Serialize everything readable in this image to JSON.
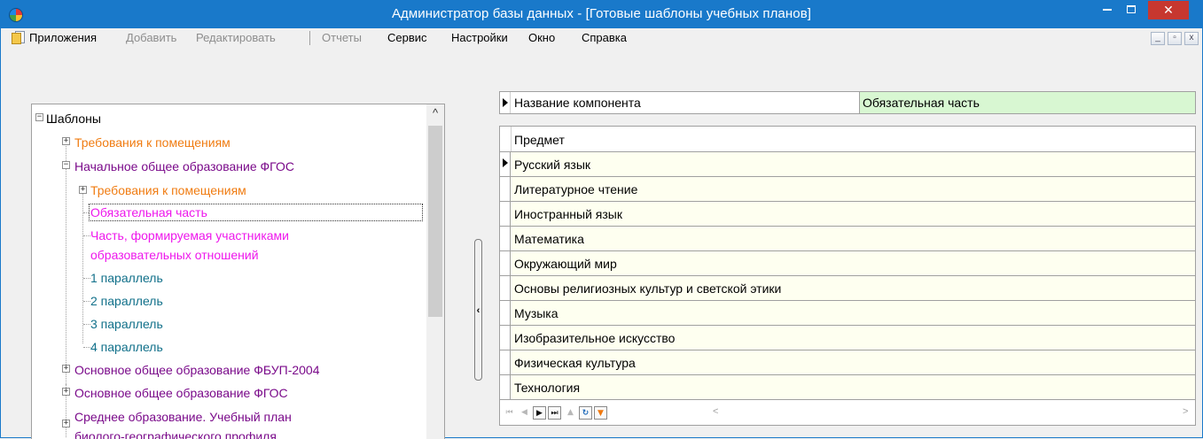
{
  "window": {
    "title": "Администратор базы данных - [Готовые шаблоны учебных планов]",
    "accent_color": "#1979ca",
    "close_color": "#c7372f",
    "min_glyph": "",
    "max_glyph": "",
    "close_glyph": "✕"
  },
  "menu": {
    "items": [
      {
        "label": "Приложения",
        "enabled": true
      },
      {
        "label": "Добавить",
        "enabled": false
      },
      {
        "label": "Редактировать",
        "enabled": false
      },
      {
        "label": "Отчеты",
        "enabled": false
      },
      {
        "label": "Сервис",
        "enabled": true
      },
      {
        "label": "Настройки",
        "enabled": true
      },
      {
        "label": "Окно",
        "enabled": true
      },
      {
        "label": "Справка",
        "enabled": true
      }
    ],
    "mdi_buttons": [
      "_",
      "▫",
      "x"
    ]
  },
  "tree": {
    "root": "Шаблоны",
    "nodes": [
      {
        "label": "Требования к помещениям",
        "color": "#f07c12"
      },
      {
        "label": "Начальное общее образование ФГОС",
        "color": "#7a0a8a"
      },
      {
        "label": "Требования к помещениям",
        "color": "#f07c12"
      },
      {
        "label": "Обязательная часть",
        "color": "#ee17ec"
      },
      {
        "label": "Часть, формируемая участниками",
        "color": "#ee17ec"
      },
      {
        "label": "образовательных отношений",
        "color": "#ee17ec"
      },
      {
        "label": "1 параллель",
        "color": "#11708a"
      },
      {
        "label": "2 параллель",
        "color": "#11708a"
      },
      {
        "label": "3 параллель",
        "color": "#11708a"
      },
      {
        "label": "4 параллель",
        "color": "#11708a"
      },
      {
        "label": "Основное общее образование ФБУП-2004",
        "color": "#7a0a8a"
      },
      {
        "label": "Основное общее образование ФГОС",
        "color": "#7a0a8a"
      },
      {
        "label": "Среднее образование. Учебный план",
        "color": "#7a0a8a"
      },
      {
        "label": "биолого-географического профиля",
        "color": "#7a0a8a"
      }
    ],
    "expand_glyph": "+",
    "collapse_glyph": "−",
    "scroll_up_glyph": "^"
  },
  "splitter": {
    "glyph": "‹"
  },
  "component": {
    "label": "Название компонента",
    "value": "Обязательная часть",
    "value_bg": "#d8f7d2"
  },
  "grid": {
    "header": "Предмет",
    "rows": [
      "Русский язык",
      "Литературное чтение",
      "Иностранный язык",
      "Математика",
      "Окружающий мир",
      "Основы религиозных культур и светской этики",
      "Музыка",
      "Изобразительное искусство",
      "Физическая культура",
      "Технология"
    ],
    "row_bg": "#fefff0"
  },
  "navigator": {
    "buttons": [
      "⏮",
      "◀",
      "▶",
      "⏭",
      "▲",
      "↻",
      "▼"
    ],
    "scroll_left": "<",
    "scroll_right": ">"
  }
}
